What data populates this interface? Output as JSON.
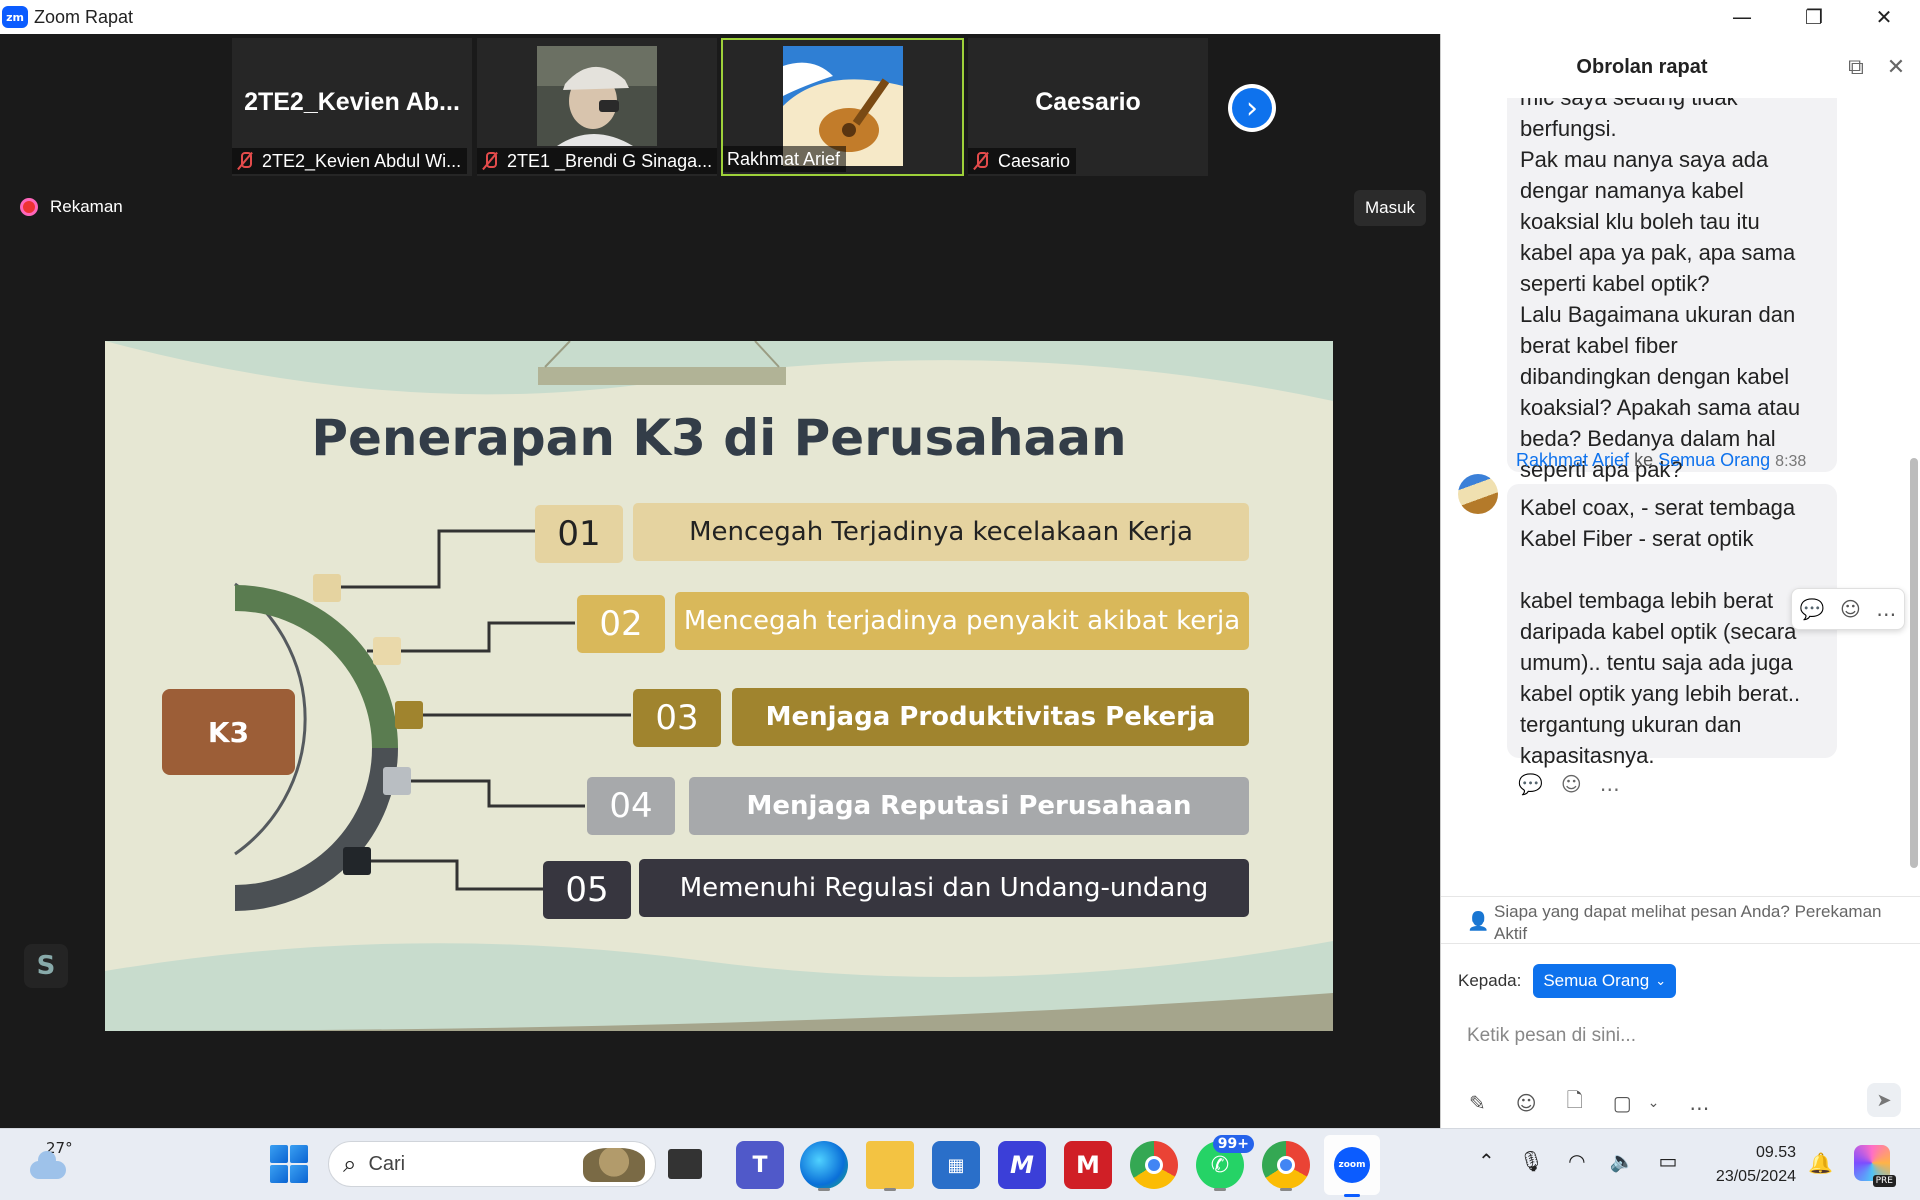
{
  "window": {
    "app_icon_text": "zm",
    "title": "Zoom Rapat",
    "controls": {
      "minimize": "—",
      "restore": "❐",
      "close": "✕"
    }
  },
  "participants": [
    {
      "big_name": "2TE2_Kevien  Ab...",
      "label": "2TE2_Kevien Abdul Wi...",
      "muted": true
    },
    {
      "big_name": "",
      "label": "2TE1 _Brendi G Sinaga...",
      "muted": true
    },
    {
      "big_name": "",
      "label": "Rakhmat Arief",
      "muted": false,
      "active": true
    },
    {
      "big_name": "Caesario",
      "label": "Caesario",
      "muted": true
    }
  ],
  "recording_label": "Rekaman",
  "enter_button": "Masuk",
  "slide": {
    "title": "Penerapan K3 di Perusahaan",
    "center_label": "K3",
    "items": [
      {
        "num": "01",
        "text": "Mencegah Terjadinya kecelakaan Kerja",
        "num_bg": "#e5d3a0",
        "num_color": "#222222",
        "label_bg": "#e5d3a0",
        "label_color": "#222222"
      },
      {
        "num": "02",
        "text": "Mencegah terjadinya penyakit akibat kerja",
        "num_bg": "#d9b85a",
        "num_color": "#ffffff",
        "label_bg": "#d9b85a",
        "label_color": "#ffffff"
      },
      {
        "num": "03",
        "text": "Menjaga Produktivitas Pekerja",
        "num_bg": "#a0842e",
        "num_color": "#ffffff",
        "label_bg": "#a0842e",
        "label_color": "#ffffff"
      },
      {
        "num": "04",
        "text": "Menjaga Reputasi Perusahaan",
        "num_bg": "#a7a9ab",
        "num_color": "#ffffff",
        "label_bg": "#a7a9ab",
        "label_color": "#ffffff"
      },
      {
        "num": "05",
        "text": "Memenuhi Regulasi dan Undang-undang",
        "num_bg": "#37363f",
        "num_color": "#ffffff",
        "label_bg": "#37363f",
        "label_color": "#ffffff"
      }
    ]
  },
  "chat": {
    "title": "Obrolan rapat",
    "prev_message": "mic saya sedang tidak\nberfungsi.\nPak mau nanya saya ada\ndengar namanya kabel\nkoaksial klu boleh tau itu\nkabel apa ya pak, apa sama\nseperti kabel optik?\nLalu Bagaimana ukuran dan\nberat kabel fiber\ndibandingkan dengan kabel\nkoaksial? Apakah sama atau\nbeda? Bedanya dalam hal\nseperti apa pak?",
    "sender": "Rakhmat Arief",
    "to_word": "ke",
    "recipient": "Semua Orang",
    "time": "8:38",
    "message": "Kabel coax, - serat tembaga\nKabel Fiber - serat optik\n\nkabel tembaga lebih berat\ndaripada kabel optik (secara\numum).. tentu saja ada juga\nkabel optik yang lebih berat..\ntergantung ukuran dan\nkapasitasnya.",
    "privacy_notice": "Siapa yang dapat melihat pesan Anda? Perekaman Aktif",
    "to_label": "Kepada:",
    "to_value": "Semua Orang",
    "input_placeholder": "Ketik pesan di sini..."
  },
  "taskbar": {
    "temperature": "27°",
    "search_label": "Cari",
    "whatsapp_badge": "99+",
    "time": "09.53",
    "date": "23/05/2024",
    "copilot_tag": "PRE"
  }
}
